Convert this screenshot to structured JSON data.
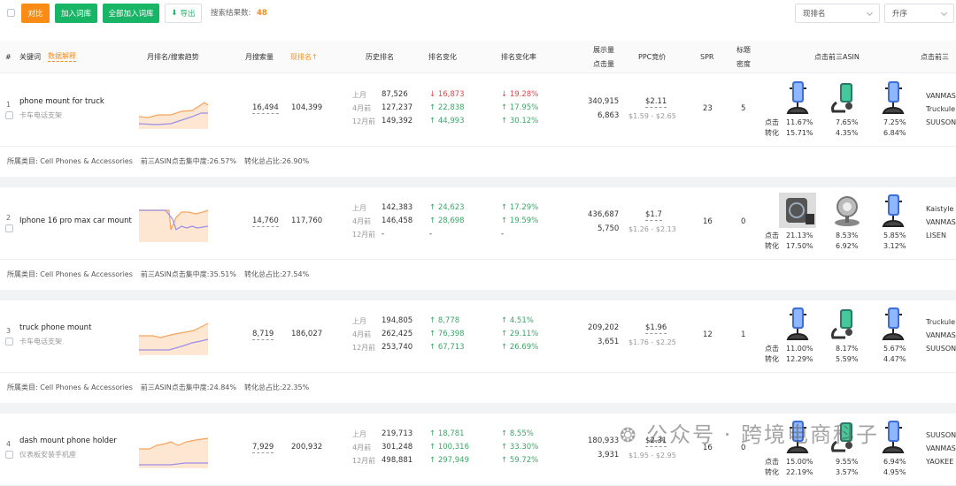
{
  "toolbar": {
    "compare": "对比",
    "add_lib": "加入词库",
    "add_all": "全部加入词库",
    "export": "导出",
    "result_label": "搜索结果数:",
    "result_count": "48",
    "sort_field": "现排名",
    "sort_order": "升序"
  },
  "header": {
    "index": "#",
    "keyword": "关键词",
    "data_explain": "数据解释",
    "trend": "月排名/搜索趋势",
    "monthly_search": "月搜索量",
    "rank_now": "现排名↑",
    "history": "历史排名",
    "rank_change": "排名变化",
    "rank_rate": "排名变化率",
    "impressions": "展示量",
    "clicks": "点击量",
    "ppc": "PPC竞价",
    "spr": "SPR",
    "title_density_1": "标题",
    "title_density_2": "密度",
    "top3_asin": "点击前三ASIN",
    "top3_brand": "点击前三"
  },
  "labels": {
    "last_month": "上月",
    "m4": "4月前",
    "m12": "12月前",
    "click": "点击",
    "conv": "转化"
  },
  "rows": [
    {
      "index": "1",
      "keyword": "phone mount for truck",
      "sub": "卡车电话支架",
      "search": "16,494",
      "rank": "104,399",
      "hist": [
        "87,526",
        "127,237",
        "149,392"
      ],
      "chg": [
        "↓ 16,873",
        "↑ 22,838",
        "↑ 44,993"
      ],
      "rate": [
        "↓ 19.28%",
        "↑ 17.95%",
        "↑ 30.12%"
      ],
      "chg_dir": [
        "down",
        "up",
        "up"
      ],
      "impr": "340,915",
      "clk": "6,863",
      "ppc": "$2.11",
      "ppc_range": "$1.59 - $2.65",
      "spr": "23",
      "density": "5",
      "asin_click": [
        "11.67%",
        "7.65%",
        "7.25%"
      ],
      "asin_conv": [
        "15.71%",
        "4.35%",
        "6.84%"
      ],
      "brands": [
        "VANMAS",
        "Truckule",
        "SUUSON"
      ],
      "thumbs": [
        "mount",
        "charger",
        "mount"
      ],
      "footer_cat": "所属类目: Cell Phones & Accessories",
      "footer_top": "前三ASIN点击集中度:26.57%",
      "footer_conv": "转化总占比:26.90%"
    },
    {
      "index": "2",
      "keyword": "Iphone 16 pro max car mount",
      "sub": "",
      "search": "14,760",
      "rank": "117,760",
      "hist": [
        "142,383",
        "146,458",
        "-"
      ],
      "chg": [
        "↑ 24,623",
        "↑ 28,698",
        "-"
      ],
      "rate": [
        "↑ 17.29%",
        "↑ 19.59%",
        "-"
      ],
      "chg_dir": [
        "up",
        "up",
        "none"
      ],
      "impr": "436,687",
      "clk": "5,750",
      "ppc": "$1.7",
      "ppc_range": "$1.26 - $2.13",
      "spr": "16",
      "density": "0",
      "asin_click": [
        "21.13%",
        "8.53%",
        "5.85%"
      ],
      "asin_conv": [
        "17.50%",
        "6.92%",
        "3.12%"
      ],
      "brands": [
        "Kaistyle",
        "VANMAS",
        "LISEN"
      ],
      "thumbs": [
        "magsafe",
        "round",
        "mount"
      ],
      "footer_cat": "所属类目: Cell Phones & Accessories",
      "footer_top": "前三ASIN点击集中度:35.51%",
      "footer_conv": "转化总占比:27.54%"
    },
    {
      "index": "3",
      "keyword": "truck phone mount",
      "sub": "卡车电话支架",
      "search": "8,719",
      "rank": "186,027",
      "hist": [
        "194,805",
        "262,425",
        "253,740"
      ],
      "chg": [
        "↑ 8,778",
        "↑ 76,398",
        "↑ 67,713"
      ],
      "rate": [
        "↑ 4.51%",
        "↑ 29.11%",
        "↑ 26.69%"
      ],
      "chg_dir": [
        "up",
        "up",
        "up"
      ],
      "impr": "209,202",
      "clk": "3,651",
      "ppc": "$1.96",
      "ppc_range": "$1.76 - $2.25",
      "spr": "12",
      "density": "1",
      "asin_click": [
        "11.00%",
        "8.17%",
        "5.67%"
      ],
      "asin_conv": [
        "12.29%",
        "5.59%",
        "4.47%"
      ],
      "brands": [
        "Truckule",
        "VANMAS",
        "SUUSON"
      ],
      "thumbs": [
        "mount",
        "charger",
        "mount"
      ],
      "footer_cat": "所属类目: Cell Phones & Accessories",
      "footer_top": "前三ASIN点击集中度:24.84%",
      "footer_conv": "转化总占比:22.35%"
    },
    {
      "index": "4",
      "keyword": "dash mount phone holder",
      "sub": "仪表板安装手机座",
      "search": "7,929",
      "rank": "200,932",
      "hist": [
        "219,713",
        "301,248",
        "498,881"
      ],
      "chg": [
        "↑ 18,781",
        "↑ 100,316",
        "↑ 297,949"
      ],
      "rate": [
        "↑ 8.55%",
        "↑ 33.30%",
        "↑ 59.72%"
      ],
      "chg_dir": [
        "up",
        "up",
        "up"
      ],
      "impr": "180,933",
      "clk": "3,931",
      "ppc": "$2.31",
      "ppc_range": "$1.95 - $2.95",
      "spr": "16",
      "density": "0",
      "asin_click": [
        "15.00%",
        "9.55%",
        "6.94%"
      ],
      "asin_conv": [
        "22.19%",
        "3.57%",
        "4.95%"
      ],
      "brands": [
        "SUUSON",
        "VANMAS",
        "YAOKEE"
      ],
      "thumbs": [
        "mount",
        "charger",
        "mount"
      ]
    }
  ],
  "colors": {
    "orange": "#fa8c16",
    "green": "#18b566",
    "up": "#3aa667",
    "down": "#e0464a"
  },
  "watermark": "公众号 · 跨境电商科子"
}
